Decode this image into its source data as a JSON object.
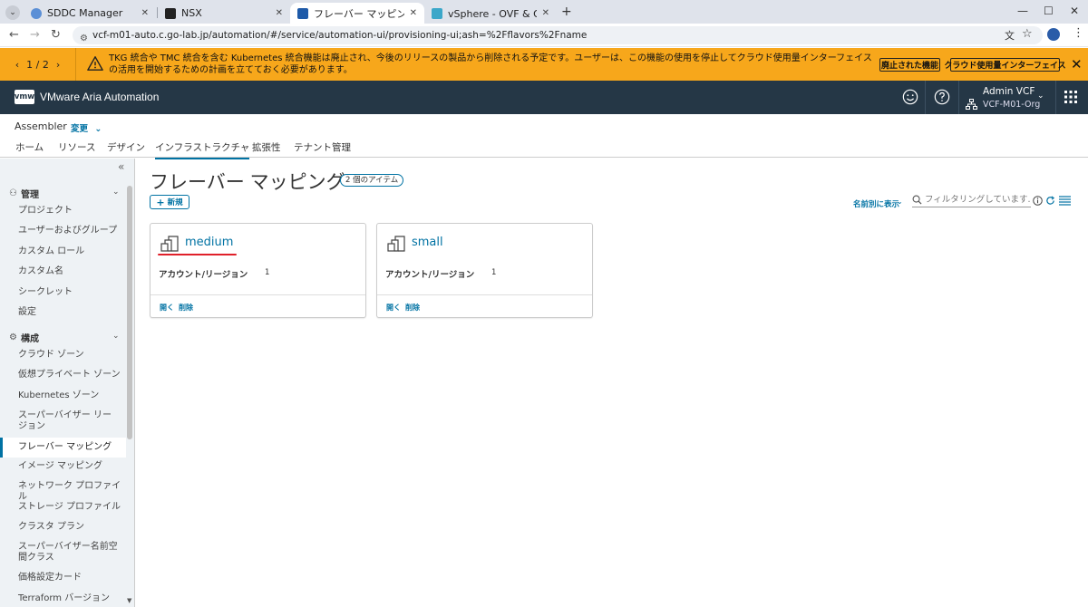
{
  "browser": {
    "tabs": [
      {
        "label": "SDDC Manager",
        "active": false,
        "favicon_color": "#5b8fd6"
      },
      {
        "label": "NSX",
        "active": false,
        "favicon_color": "#222222"
      },
      {
        "label": "フレーバー マッピング - Assembler",
        "active": true,
        "favicon_color": "#1e5aa8"
      },
      {
        "label": "vSphere - OVF & OVA テンプレー",
        "active": false,
        "favicon_color": "#3ba7c9"
      }
    ],
    "url": "vcf-m01-auto.c.go-lab.jp/automation/#/service/automation-ui/provisioning-ui;ash=%2Fflavors%2Fname"
  },
  "banner": {
    "pager": "1 / 2",
    "message": "TKG 統合や TMC 統合を含む Kubernetes 統合機能は廃止され、今後のリリースの製品から削除される予定です。ユーザーは、この機能の使用を停止してクラウド使用量インターフェイスの活用を開始するための計画を立てておく必要があります。",
    "btn_deprecated": "廃止された機能",
    "btn_consumption": "クラウド使用量インターフェイス",
    "color": "#f7a71b"
  },
  "header": {
    "logo": "vmw",
    "product": "VMware Aria Automation",
    "user": "Admin VCF",
    "org": "VCF-M01-Org",
    "color": "#253746"
  },
  "service": {
    "title": "Assembler",
    "change": "変更",
    "tabs": [
      "ホーム",
      "リソース",
      "デザイン",
      "インフラストラクチャ",
      "拡張性",
      "テナント管理"
    ],
    "active_tab": "インフラストラクチャ"
  },
  "sidebar": {
    "groups": [
      {
        "label": "管理",
        "items": [
          "プロジェクト",
          "ユーザーおよびグループ",
          "カスタム ロール",
          "カスタム名",
          "シークレット",
          "設定"
        ]
      },
      {
        "label": "構成",
        "items": [
          "クラウド ゾーン",
          "仮想プライベート ゾーン",
          "Kubernetes ゾーン",
          "スーパーバイザー リージョン",
          "フレーバー マッピング",
          "イメージ マッピング",
          "ネットワーク プロファイル",
          "ストレージ プロファイル",
          "クラスタ プラン",
          "スーパーバイザー名前空間クラス",
          "価格設定カード",
          "Terraform バージョン"
        ]
      }
    ],
    "active_item": "フレーバー マッピング"
  },
  "main": {
    "title": "フレーバー マッピング",
    "count": "2 個のアイテム",
    "new_button": "新規",
    "sort_label": "名前別に表示",
    "filter_placeholder": "フィルタリングしています...",
    "cards": [
      {
        "name": "medium",
        "label": "アカウント/リージョン",
        "count": "1",
        "open": "開く",
        "delete": "削除"
      },
      {
        "name": "small",
        "label": "アカウント/リージョン",
        "count": "1",
        "open": "開く",
        "delete": "削除"
      }
    ],
    "accent": "#0072a3",
    "highlight": "#e0202a"
  }
}
